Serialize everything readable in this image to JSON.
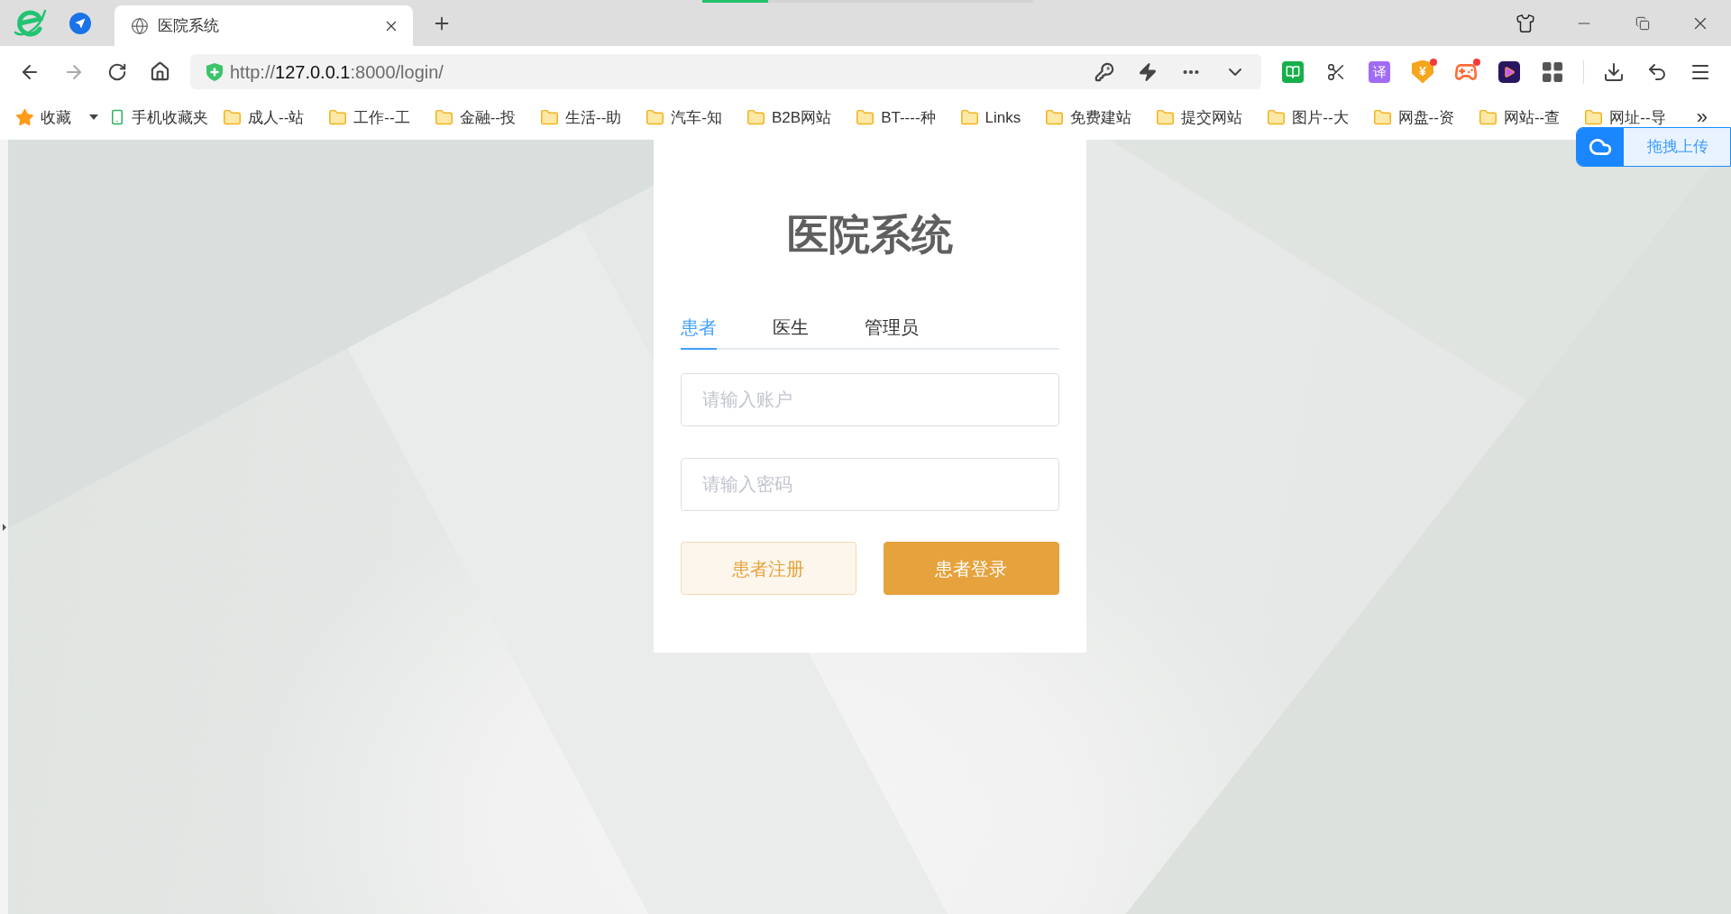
{
  "browser": {
    "tab": {
      "title": "医院系统"
    },
    "loading_bar": {
      "level": 0.2
    },
    "address_bar": {
      "url_parts": [
        {
          "text": "http://",
          "highlight": false
        },
        {
          "text": "127.0.0.1",
          "highlight": true
        },
        {
          "text": ":8000/login/",
          "highlight": false
        }
      ]
    },
    "extensions": [
      {
        "kind": "reader",
        "badge": false
      },
      {
        "kind": "scissors",
        "badge": false
      },
      {
        "kind": "translate",
        "label": "译",
        "badge": false
      },
      {
        "kind": "wallet",
        "label": "¥",
        "badge": true
      },
      {
        "kind": "game",
        "badge": true
      },
      {
        "kind": "video",
        "badge": false
      },
      {
        "kind": "apps",
        "badge": false
      }
    ],
    "bookmarks": [
      {
        "kind": "favorites",
        "label": "收藏"
      },
      {
        "kind": "mobile",
        "label": "手机收藏夹"
      },
      {
        "kind": "folder",
        "label": "成人--站"
      },
      {
        "kind": "folder",
        "label": "工作--工"
      },
      {
        "kind": "folder",
        "label": "金融--投"
      },
      {
        "kind": "folder",
        "label": "生活--助"
      },
      {
        "kind": "folder",
        "label": "汽车-知"
      },
      {
        "kind": "folder",
        "label": "B2B网站"
      },
      {
        "kind": "folder",
        "label": "BT----种"
      },
      {
        "kind": "folder",
        "label": "Links"
      },
      {
        "kind": "folder",
        "label": "免费建站"
      },
      {
        "kind": "folder",
        "label": "提交网站"
      },
      {
        "kind": "folder",
        "label": "图片--大"
      },
      {
        "kind": "folder",
        "label": "网盘--资"
      },
      {
        "kind": "folder",
        "label": "网站--查"
      },
      {
        "kind": "folder",
        "label": "网址--导"
      }
    ],
    "bookmarks_more": "»"
  },
  "upload_widget": {
    "label": "拖拽上传"
  },
  "login": {
    "title": "医院系统",
    "tabs": [
      {
        "label": "患者",
        "selected": true
      },
      {
        "label": "医生",
        "selected": false
      },
      {
        "label": "管理员",
        "selected": false
      }
    ],
    "fields": [
      {
        "placeholder": "请输入账户"
      },
      {
        "placeholder": "请输入密码"
      }
    ],
    "buttons": [
      {
        "kind": "plain",
        "label": "患者注册"
      },
      {
        "kind": "primary",
        "label": "患者登录"
      }
    ]
  }
}
